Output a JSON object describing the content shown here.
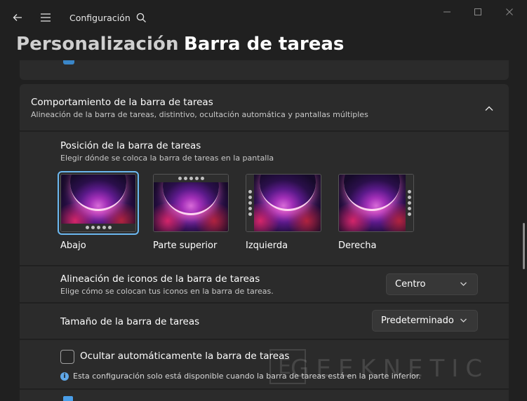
{
  "window": {
    "app_title": "Configuración"
  },
  "breadcrumb": {
    "parent": "Personalización",
    "current": "Barra de tareas"
  },
  "section": {
    "title": "Comportamiento de la barra de tareas",
    "subtitle": "Alineación de la barra de tareas, distintivo, ocultación automática y pantallas múltiples"
  },
  "taskbar_position": {
    "title": "Posición de la barra de tareas",
    "subtitle": "Elegir dónde se coloca la barra de tareas en la pantalla",
    "options": [
      {
        "label": "Abajo",
        "selected": true
      },
      {
        "label": "Parte superior",
        "selected": false
      },
      {
        "label": "Izquierda",
        "selected": false
      },
      {
        "label": "Derecha",
        "selected": false
      }
    ]
  },
  "alignment": {
    "title": "Alineación de iconos de la barra de tareas",
    "subtitle": "Elige cómo se colocan tus iconos en la barra de tareas.",
    "value": "Centro"
  },
  "size": {
    "title": "Tamaño de la barra de tareas",
    "value": "Predeterminado"
  },
  "autohide": {
    "label": "Ocultar automáticamente la barra de tareas",
    "checked": false,
    "info": "Esta configuración solo está disponible cuando la barra de tareas está en la parte inferior."
  },
  "watermark": {
    "text": "GEEKNETIC"
  },
  "icons": {
    "back": "back-arrow-icon",
    "menu": "hamburger-menu-icon",
    "search": "search-icon",
    "minimize": "minimize-icon",
    "maximize": "maximize-icon",
    "close": "close-icon",
    "breadcrumb_separator": "chevron-right-icon",
    "collapse": "chevron-up-icon",
    "dropdown": "chevron-down-icon",
    "info": "info-icon"
  },
  "colors": {
    "background": "#202020",
    "card": "#2b2b2b",
    "accent": "#6cb8f0",
    "info": "#60a8e8"
  }
}
